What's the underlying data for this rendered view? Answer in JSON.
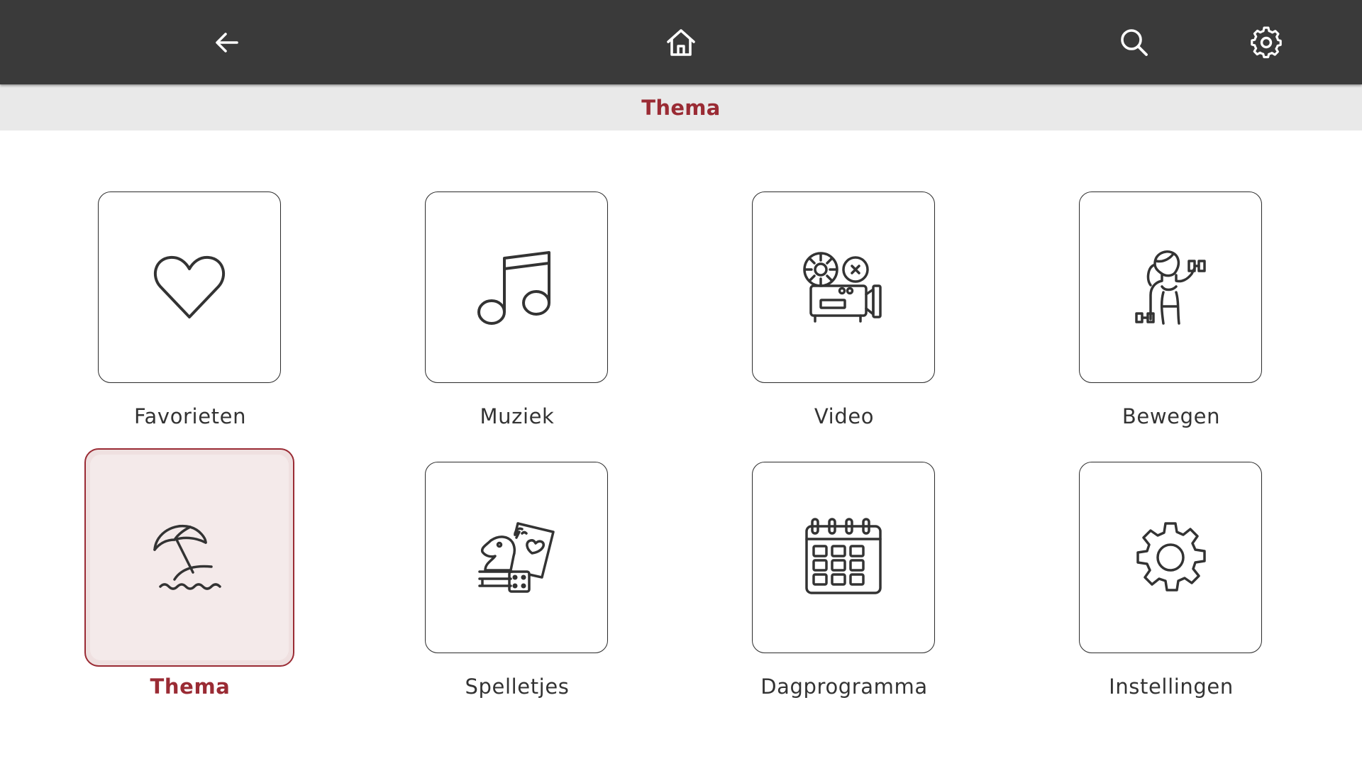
{
  "app": {
    "page_title": "Thema",
    "accent_color": "#9a2b34",
    "topbar_color": "#3a3a3a"
  },
  "topbar": {
    "back_icon": "arrow-left-icon",
    "home_icon": "home-icon",
    "search_icon": "search-icon",
    "settings_icon": "gear-icon"
  },
  "tiles": [
    {
      "label": "Favorieten",
      "icon": "heart-icon",
      "active": false
    },
    {
      "label": "Muziek",
      "icon": "music-note-icon",
      "active": false
    },
    {
      "label": "Video",
      "icon": "film-projector-icon",
      "active": false
    },
    {
      "label": "Bewegen",
      "icon": "fitness-woman-icon",
      "active": false
    },
    {
      "label": "Thema",
      "icon": "beach-umbrella-icon",
      "active": true
    },
    {
      "label": "Spelletjes",
      "icon": "games-icon",
      "active": false
    },
    {
      "label": "Dagprogramma",
      "icon": "calendar-icon",
      "active": false
    },
    {
      "label": "Instellingen",
      "icon": "gear-icon",
      "active": false
    }
  ]
}
